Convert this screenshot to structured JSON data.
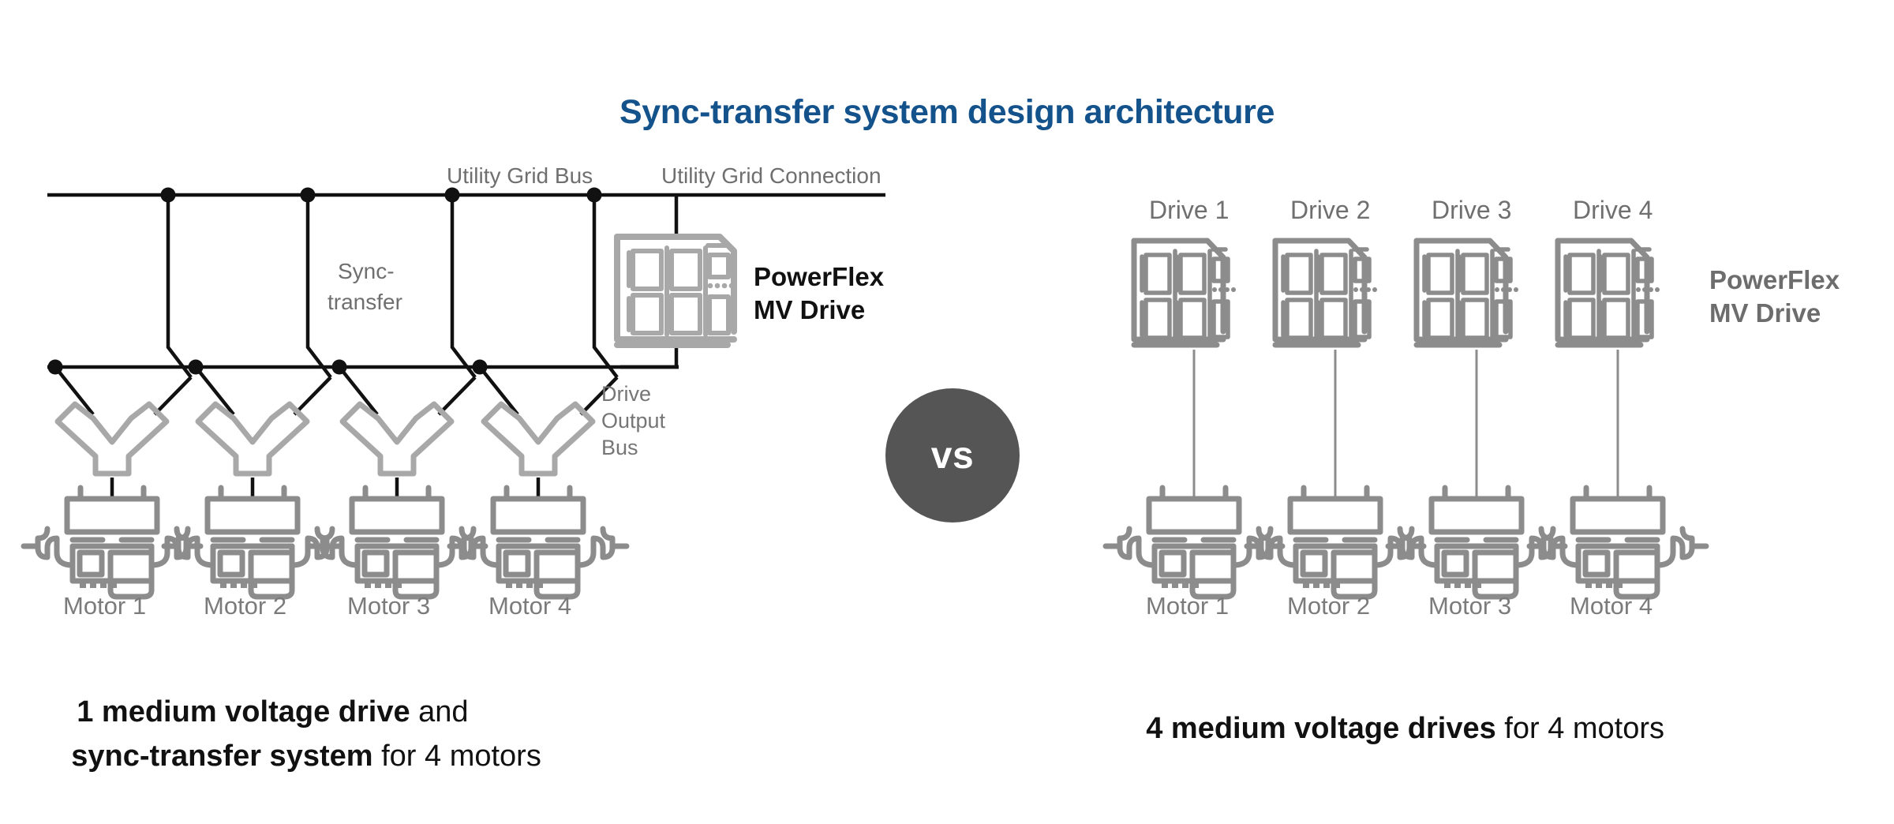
{
  "title": "Sync-transfer system design architecture",
  "brand_color": "#14528c",
  "vs_badge": {
    "label": "vs",
    "color": "#555555"
  },
  "left": {
    "bus_labels": {
      "utility_grid_bus": "Utility Grid Bus",
      "utility_grid_connection": "Utility Grid Connection",
      "sync_transfer_line1": "Sync-",
      "sync_transfer_line2": "transfer",
      "drive_output_bus_line1": "Drive",
      "drive_output_bus_line2": "Output",
      "drive_output_bus_line3": "Bus"
    },
    "drive_label_line1": "PowerFlex",
    "drive_label_line2": "MV Drive",
    "motors": [
      "Motor 1",
      "Motor 2",
      "Motor 3",
      "Motor 4"
    ],
    "caption_line1_bold": "1 medium voltage drive",
    "caption_line1_rest": " and",
    "caption_line2_bold": "sync-transfer system",
    "caption_line2_rest": " for 4 motors"
  },
  "right": {
    "drives": [
      "Drive 1",
      "Drive 2",
      "Drive 3",
      "Drive 4"
    ],
    "drive_label_line1": "PowerFlex",
    "drive_label_line2": "MV Drive",
    "motors": [
      "Motor 1",
      "Motor 2",
      "Motor 3",
      "Motor 4"
    ],
    "caption_bold": "4 medium voltage drives",
    "caption_rest": " for 4 motors"
  }
}
